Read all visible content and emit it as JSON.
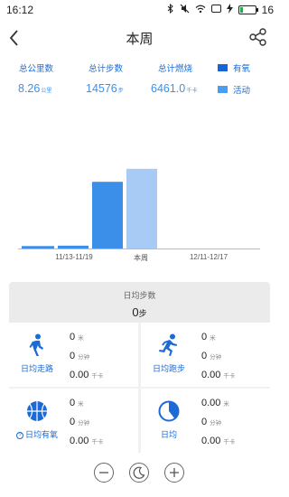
{
  "status_bar": {
    "time": "16:12",
    "battery_level": "16",
    "battery_fraction": 0.16,
    "icons": [
      "bluetooth-icon",
      "mute-icon",
      "wifi-icon",
      "screen-icon",
      "charging-icon",
      "battery-icon"
    ]
  },
  "header": {
    "title": "本周",
    "back_icon": "chevron-left-icon",
    "share_icon": "share-icon"
  },
  "stats": {
    "distance": {
      "label": "总公里数",
      "value": "8.26",
      "unit": "公里"
    },
    "steps": {
      "label": "总计步数",
      "value": "14576",
      "unit": "步"
    },
    "calories": {
      "label": "总计燃烧",
      "value": "6461.0",
      "unit": "千卡"
    },
    "legend": [
      {
        "label": "有氧",
        "color": "#1565d8"
      },
      {
        "label": "活动",
        "color": "#4a9ef0"
      }
    ]
  },
  "chart_data": {
    "type": "bar",
    "x": [
      "11/13-11/19",
      "本周",
      "12/11-12/17"
    ],
    "series_colors": [
      "#3b8fe8",
      "#a7cbf4"
    ],
    "bars_note": "values estimated relative to max",
    "series": [
      {
        "values": [
          0.03,
          0.035,
          0.82,
          0.98,
          0,
          0
        ]
      }
    ],
    "ylim": [
      0,
      1
    ],
    "grid": false
  },
  "summary": {
    "label": "日均步数",
    "value": "0",
    "unit": "步"
  },
  "cells": [
    {
      "icon": "walking-icon",
      "label": "日均走路",
      "lines": [
        {
          "v": "0",
          "u": "米"
        },
        {
          "v": "0",
          "u": "分钟"
        },
        {
          "v": "0.00",
          "u": "千卡"
        }
      ]
    },
    {
      "icon": "running-icon",
      "label": "日均跑步",
      "lines": [
        {
          "v": "0",
          "u": "米"
        },
        {
          "v": "0",
          "u": "分钟"
        },
        {
          "v": "0.00",
          "u": "千卡"
        }
      ]
    },
    {
      "icon": "basketball-icon",
      "label": "日均有氧",
      "lines": [
        {
          "v": "0",
          "u": "米"
        },
        {
          "v": "0",
          "u": "分钟"
        },
        {
          "v": "0.00",
          "u": "千卡"
        }
      ]
    },
    {
      "icon": "pie-icon",
      "label": "日均",
      "lines": [
        {
          "v": "0.00",
          "u": "米"
        },
        {
          "v": "0",
          "u": "分钟"
        },
        {
          "v": "0.00",
          "u": "千卡"
        }
      ]
    }
  ],
  "controls": {
    "zoom_out_icon": "minus-circle-icon",
    "night_icon": "moon-icon",
    "zoom_in_icon": "plus-circle-icon"
  }
}
